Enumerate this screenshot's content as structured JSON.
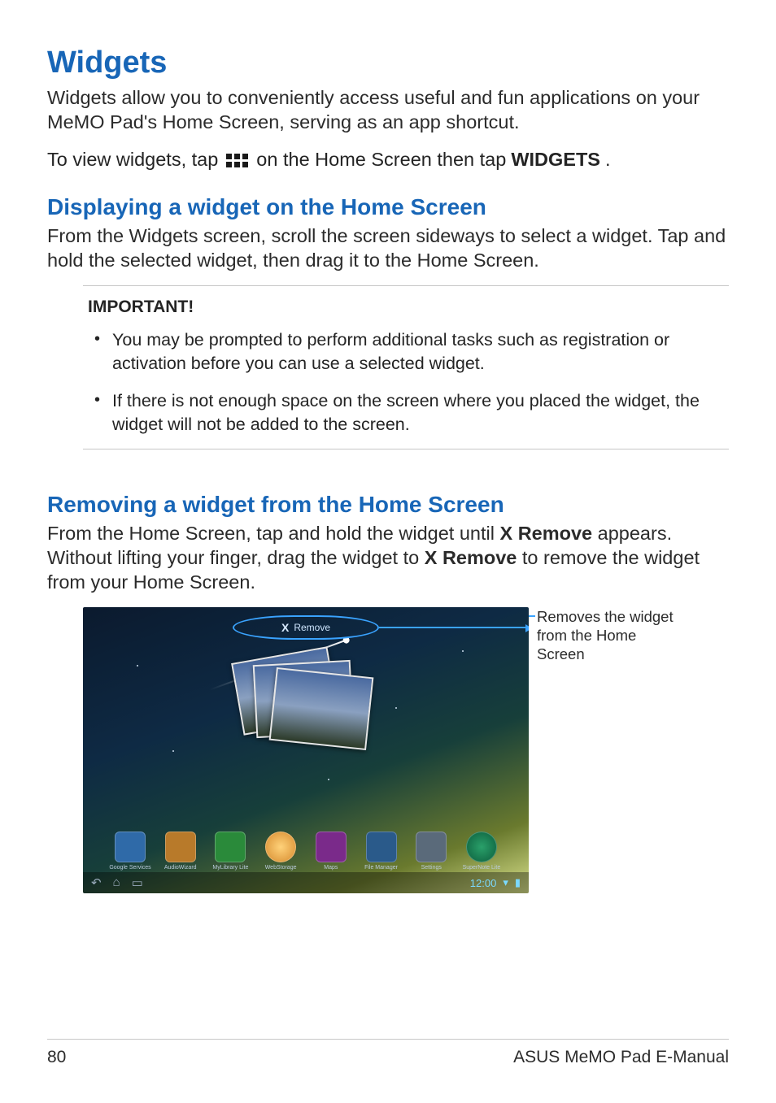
{
  "title": "Widgets",
  "intro": "Widgets allow you to conveniently access useful and fun applications on your MeMO Pad's Home Screen, serving as an app shortcut.",
  "view_line": {
    "pre": "To view widgets, tap",
    "post_pre": "on the Home Screen then tap",
    "bold": "WIDGETS",
    "period": "."
  },
  "section_display": {
    "heading": "Displaying a widget on the Home Screen",
    "body": "From the Widgets screen, scroll the screen sideways to select a widget. Tap and hold the selected widget, then drag it to the Home Screen."
  },
  "important": {
    "label": "IMPORTANT!",
    "items": [
      "You may be prompted to perform additional tasks such as registration or activation before you can use a selected widget.",
      "If there is not enough space on the screen where you placed the widget, the widget will not be added to the screen."
    ]
  },
  "section_remove": {
    "heading": "Removing a widget from the Home Screen",
    "body_pre": "From the Home Screen, tap and hold the widget until ",
    "bold1": "X Remove",
    "body_mid": " appears. Without lifting your finger, drag the widget to ",
    "bold2": "X Remove",
    "body_post": " to remove the widget from your Home Screen."
  },
  "screenshot": {
    "remove_label": "Remove",
    "remove_x": "X",
    "clock": "12:00",
    "dock": [
      "Google Services",
      "AudioWizard",
      "MyLibrary Lite",
      "WebStorage",
      "Maps",
      "File Manager",
      "Settings",
      "SuperNote Lite"
    ]
  },
  "callout": "Removes the widget from the Home Screen",
  "footer": {
    "page": "80",
    "doc": "ASUS MeMO Pad E-Manual"
  }
}
